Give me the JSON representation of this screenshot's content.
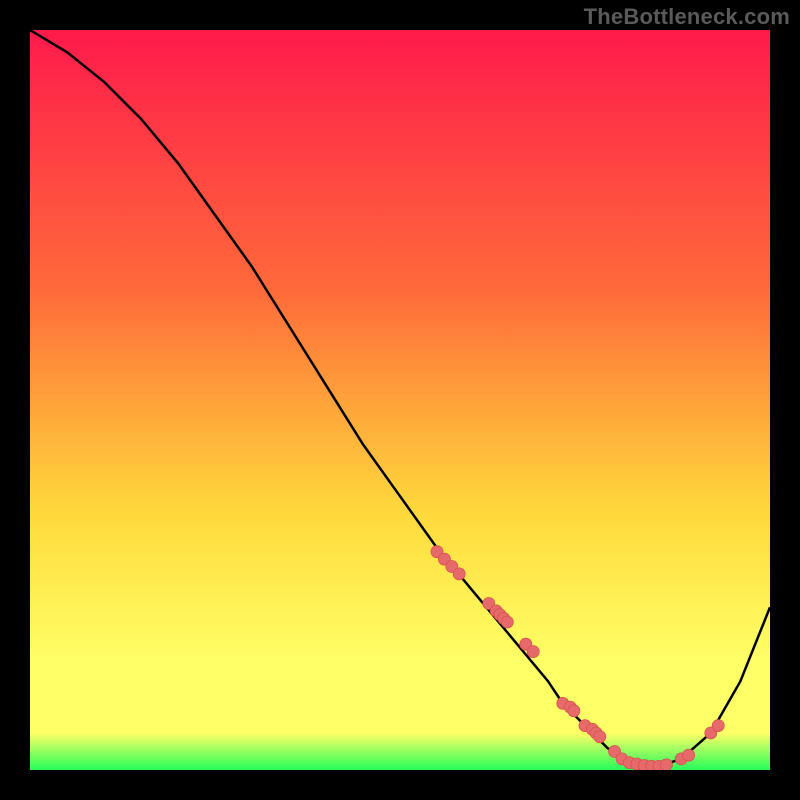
{
  "watermark": "TheBottleneck.com",
  "colors": {
    "grad_top": "#ff1a4c",
    "grad_mid1": "#ff6a3a",
    "grad_mid2": "#ffd93b",
    "grad_mid3": "#ffff66",
    "grad_bottom": "#26ff5b",
    "curve": "#000000",
    "marker_fill": "#e76a6a",
    "marker_stroke": "#d94f4f",
    "black": "#000000"
  },
  "chart_data": {
    "type": "line",
    "title": "",
    "xlabel": "",
    "ylabel": "",
    "xlim": [
      0,
      100
    ],
    "ylim": [
      0,
      100
    ],
    "grid": false,
    "legend": false,
    "series": [
      {
        "name": "bottleneck-curve",
        "x": [
          0,
          5,
          10,
          15,
          20,
          25,
          30,
          35,
          40,
          45,
          50,
          55,
          60,
          65,
          70,
          72,
          75,
          78,
          80,
          82,
          85,
          88,
          92,
          96,
          100
        ],
        "y": [
          100,
          97,
          93,
          88,
          82,
          75,
          68,
          60,
          52,
          44,
          37,
          30,
          24,
          18,
          12,
          9,
          6,
          3,
          1.5,
          0.8,
          0.5,
          1.5,
          5,
          12,
          22
        ]
      }
    ],
    "markers": {
      "name": "data-points",
      "x": [
        55,
        56,
        57,
        58,
        62,
        63,
        63.5,
        64,
        64.5,
        67,
        68,
        72,
        73,
        73.5,
        75,
        76,
        76.5,
        77,
        79,
        80,
        81,
        82,
        83,
        84,
        85,
        86,
        88,
        89,
        92,
        93
      ],
      "y": [
        29.5,
        28.5,
        27.5,
        26.5,
        22.5,
        21.5,
        21,
        20.5,
        20,
        17,
        16,
        9,
        8.5,
        8,
        6,
        5.5,
        5,
        4.5,
        2.5,
        1.5,
        1,
        0.8,
        0.6,
        0.5,
        0.5,
        0.7,
        1.5,
        2,
        5,
        6
      ]
    }
  }
}
